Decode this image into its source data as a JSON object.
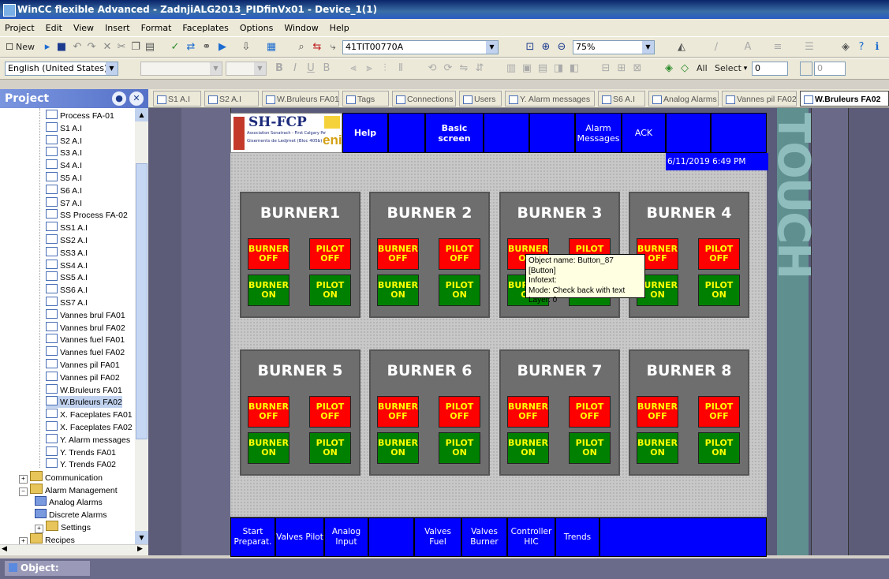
{
  "window": {
    "title": "WinCC flexible Advanced - ZadnjiALG2013_PIDfinVx01 - Device_1(1)"
  },
  "menu": [
    "Project",
    "Edit",
    "View",
    "Insert",
    "Format",
    "Faceplates",
    "Options",
    "Window",
    "Help"
  ],
  "toolbar1": {
    "new_label": "New",
    "tag_combo": "41TIT00770A",
    "zoom_combo": "75%"
  },
  "toolbar2": {
    "language": "English (United States)",
    "all_label": "All",
    "select_label": "Select",
    "select_value": "0",
    "spin_value": "0"
  },
  "panel": {
    "title": "Project"
  },
  "tree": [
    {
      "label": "Process FA-01",
      "kind": "screen"
    },
    {
      "label": "S1 A.I",
      "kind": "screen"
    },
    {
      "label": "S2 A.I",
      "kind": "screen"
    },
    {
      "label": "S3 A.I",
      "kind": "screen"
    },
    {
      "label": "S4 A.I",
      "kind": "screen"
    },
    {
      "label": "S5 A.I",
      "kind": "screen"
    },
    {
      "label": "S6 A.I",
      "kind": "screen"
    },
    {
      "label": "S7 A.I",
      "kind": "screen"
    },
    {
      "label": "SS Process FA-02",
      "kind": "screen"
    },
    {
      "label": "SS1 A.I",
      "kind": "screen"
    },
    {
      "label": "SS2 A.I",
      "kind": "screen"
    },
    {
      "label": "SS3 A.I",
      "kind": "screen"
    },
    {
      "label": "SS4 A.I",
      "kind": "screen"
    },
    {
      "label": "SS5 A.I",
      "kind": "screen"
    },
    {
      "label": "SS6 A.I",
      "kind": "screen"
    },
    {
      "label": "SS7 A.I",
      "kind": "screen"
    },
    {
      "label": "Vannes brul FA01",
      "kind": "screen"
    },
    {
      "label": "Vannes brul FA02",
      "kind": "screen"
    },
    {
      "label": "Vannes fuel FA01",
      "kind": "screen"
    },
    {
      "label": "Vannes fuel FA02",
      "kind": "screen"
    },
    {
      "label": "Vannes pil FA01",
      "kind": "screen"
    },
    {
      "label": "Vannes pil FA02",
      "kind": "screen"
    },
    {
      "label": "W.Bruleurs FA01",
      "kind": "screen"
    },
    {
      "label": "W.Bruleurs FA02",
      "kind": "screen",
      "selected": true
    },
    {
      "label": "X. Faceplates FA01",
      "kind": "screen"
    },
    {
      "label": "X. Faceplates FA02",
      "kind": "screen"
    },
    {
      "label": "Y. Alarm messages",
      "kind": "screen"
    },
    {
      "label": "Y. Trends FA01",
      "kind": "screen"
    },
    {
      "label": "Y. Trends FA02",
      "kind": "screen"
    },
    {
      "label": "Communication",
      "kind": "folder",
      "level": 1,
      "expander": "+"
    },
    {
      "label": "Alarm Management",
      "kind": "folder",
      "level": 1,
      "expander": "-"
    },
    {
      "label": "Analog Alarms",
      "kind": "alarm",
      "level": 2
    },
    {
      "label": "Discrete Alarms",
      "kind": "alarm",
      "level": 2
    },
    {
      "label": "Settings",
      "kind": "folder",
      "level": 2,
      "expander": "+"
    },
    {
      "label": "Recipes",
      "kind": "folder",
      "level": 1,
      "expander": "+"
    }
  ],
  "tabs": [
    {
      "label": "S1 A.I"
    },
    {
      "label": "S2 A.I"
    },
    {
      "label": "W.Bruleurs FA01"
    },
    {
      "label": "Tags"
    },
    {
      "label": "Connections"
    },
    {
      "label": "Users"
    },
    {
      "label": "Y. Alarm messages"
    },
    {
      "label": "S6 A.I"
    },
    {
      "label": "Analog Alarms"
    },
    {
      "label": "Vannes pil FA02"
    },
    {
      "label": "W.Bruleurs FA02",
      "active": true
    }
  ],
  "hmi": {
    "logo_title": "SH-FCP",
    "logo_sub1": "Association Sonatrach - First Calgary Petroleums",
    "logo_sub2": "Gisements de Ledjmet (Bloc 405b)",
    "logo_brand": "eni",
    "top_buttons": [
      "Help",
      "",
      "Basic screen",
      "",
      "",
      "Alarm Messages",
      "ACK",
      "",
      ""
    ],
    "datetime": "6/11/2019 6:49 PM",
    "burners": [
      "BURNER1",
      "BURNER 2",
      "BURNER 3",
      "BURNER 4",
      "BURNER 5",
      "BURNER 6",
      "BURNER 7",
      "BURNER 8"
    ],
    "btn_burner_off": "BURNER OFF",
    "btn_pilot_off": "PILOT OFF",
    "btn_burner_on": "BURNER ON",
    "btn_pilot_on": "PILOT ON",
    "bottom_buttons": [
      "Start Preparat.",
      "Valves Pilot",
      "Analog Input",
      "",
      "Valves Fuel",
      "Valves Burner",
      "Controller HIC",
      "Trends",
      ""
    ],
    "touch_label": "TOUCH"
  },
  "tooltip": {
    "line1": "Object name: Button_87 [Button]",
    "line2": "Infotext:",
    "line3": "Mode: Check back with text",
    "line4": "Layer: 0"
  },
  "status": {
    "label": "Object:"
  },
  "colors": {
    "hmi_blue": "#0000ff",
    "off_red": "#ff0000",
    "on_green": "#008000",
    "text_yellow": "#ffff00"
  }
}
